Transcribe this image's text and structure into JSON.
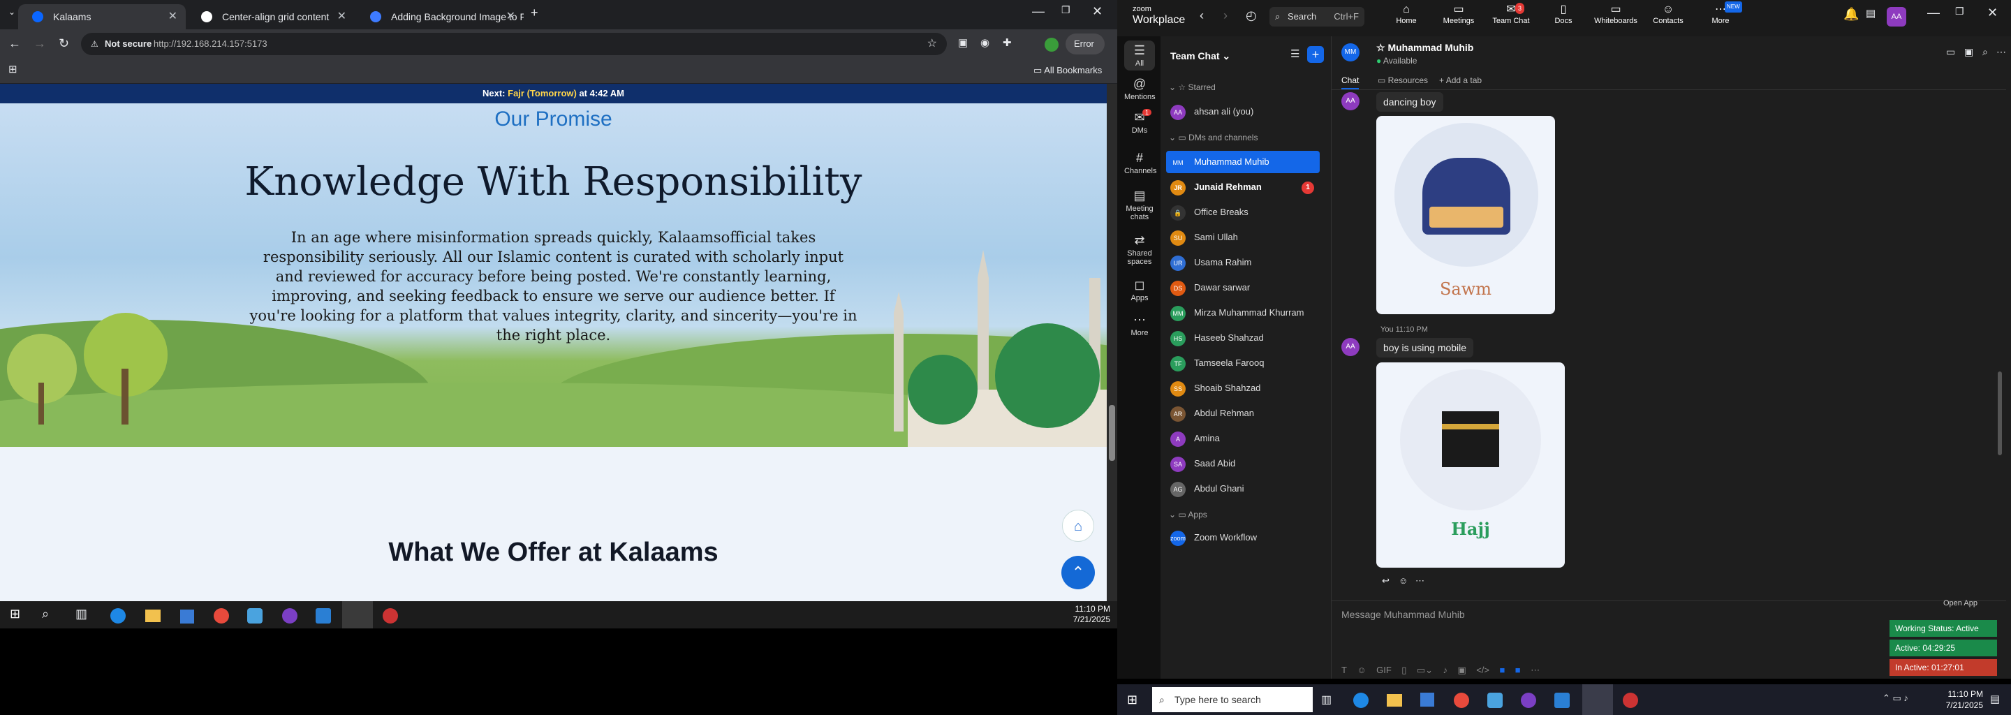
{
  "browser": {
    "tabs": [
      {
        "title": "Kalaams",
        "color": "#0a66ff"
      },
      {
        "title": "Center-align grid content",
        "color": "#ffffff"
      },
      {
        "title": "Adding Background Image to F",
        "color": "#3e7bff"
      }
    ],
    "new_tab": "+",
    "not_secure": "Not secure",
    "url": "http://192.168.214.157:5173",
    "url_host": "192.168.214.157",
    "error_label": "Error",
    "bookmarks_label": "All Bookmarks"
  },
  "page": {
    "banner_prefix": "Next: ",
    "banner_prayer": "Fajr (Tomorrow)",
    "banner_suffix": " at 4:42 AM",
    "promise_heading": "Our Promise",
    "hero_title": "Knowledge With Responsibility",
    "hero_paragraph": "In an age where misinformation spreads quickly, Kalaamsofficial takes responsibility seriously. All our Islamic content is curated with scholarly input and reviewed for accuracy before being posted. We're constantly learning, improving, and seeking feedback to ensure we serve our audience better. If you're looking for a platform that values integrity, clarity, and sincerity—you're in the right place.",
    "offer_heading": "What We Offer at Kalaams"
  },
  "left_taskbar": {
    "time": "11:10 PM",
    "date": "7/21/2025"
  },
  "zoom": {
    "logo_top": "zoom",
    "logo_bottom": "Workplace",
    "search_label": "Search",
    "search_shortcut": "Ctrl+F",
    "nav": [
      "Home",
      "Meetings",
      "Team Chat",
      "Docs",
      "Whiteboards",
      "Contacts",
      "More"
    ],
    "nav_badge": "3",
    "new_badge": "NEW",
    "user_initials": "AA",
    "rail": [
      {
        "label": "All"
      },
      {
        "label": "Mentions"
      },
      {
        "label": "DMs",
        "badge": "1"
      },
      {
        "label": "Channels"
      },
      {
        "label": "Meeting chats"
      },
      {
        "label": "Shared spaces"
      },
      {
        "label": "Apps"
      },
      {
        "label": "More"
      }
    ],
    "list_title": "Team Chat",
    "sections": {
      "starred": "Starred",
      "dms": "DMs and channels",
      "apps": "Apps"
    },
    "starred": [
      {
        "name": "ahsan ali (you)",
        "initials": "AA",
        "color": "#8e3bbf"
      }
    ],
    "contacts": [
      {
        "name": "Muhammad Muhib",
        "initials": "MM",
        "color": "#1467e8",
        "selected": true
      },
      {
        "name": "Junaid Rehman",
        "initials": "JR",
        "color": "#e08a12",
        "bold": true,
        "badge": "1"
      },
      {
        "name": "Office Breaks",
        "initials": "🔒",
        "color": "#333"
      },
      {
        "name": "Sami Ullah",
        "initials": "SU",
        "color": "#e08a12"
      },
      {
        "name": "Usama Rahim",
        "initials": "UR",
        "color": "#2f6ed4"
      },
      {
        "name": "Dawar sarwar",
        "initials": "DS",
        "color": "#e05a12"
      },
      {
        "name": "Mirza Muhammad Khurram",
        "initials": "MM",
        "color": "#2a9d5c"
      },
      {
        "name": "Haseeb Shahzad",
        "initials": "HS",
        "color": "#2a9d5c"
      },
      {
        "name": "Tamseela Farooq",
        "initials": "TF",
        "color": "#2a9d5c"
      },
      {
        "name": "Shoaib Shahzad",
        "initials": "SS",
        "color": "#e08a12"
      },
      {
        "name": "Abdul Rehman",
        "initials": "AR",
        "color": "#7a5533"
      },
      {
        "name": "Amina",
        "initials": "A",
        "color": "#8e3bbf"
      },
      {
        "name": "Saad Abid",
        "initials": "SA",
        "color": "#8e3bbf"
      },
      {
        "name": "Abdul Ghani",
        "initials": "AG",
        "color": "#666"
      }
    ],
    "apps": [
      {
        "name": "Zoom Workflow",
        "initials": "zoom",
        "color": "#1467e8"
      }
    ],
    "chat": {
      "contact_initials": "MM",
      "contact_name": "Muhammad Muhib",
      "status": "Available",
      "tabs": [
        "Chat",
        "Resources",
        "Add a tab"
      ],
      "msg1": "dancing boy",
      "card1_caption": "Sawm",
      "msg2_sender": "You",
      "msg2_time": "11:10 PM",
      "msg2": "boy is using mobile",
      "card2_caption": "Hajj",
      "input_placeholder": "Message Muhammad Muhib",
      "open_app": "Open App"
    },
    "status_widget": {
      "working": "Working Status: Active",
      "active": "Active: 04:29:25",
      "inactive": "In Active: 01:27:01"
    }
  },
  "right_taskbar": {
    "search_placeholder": "Type here to search",
    "time": "11:10 PM",
    "date": "7/21/2025"
  }
}
